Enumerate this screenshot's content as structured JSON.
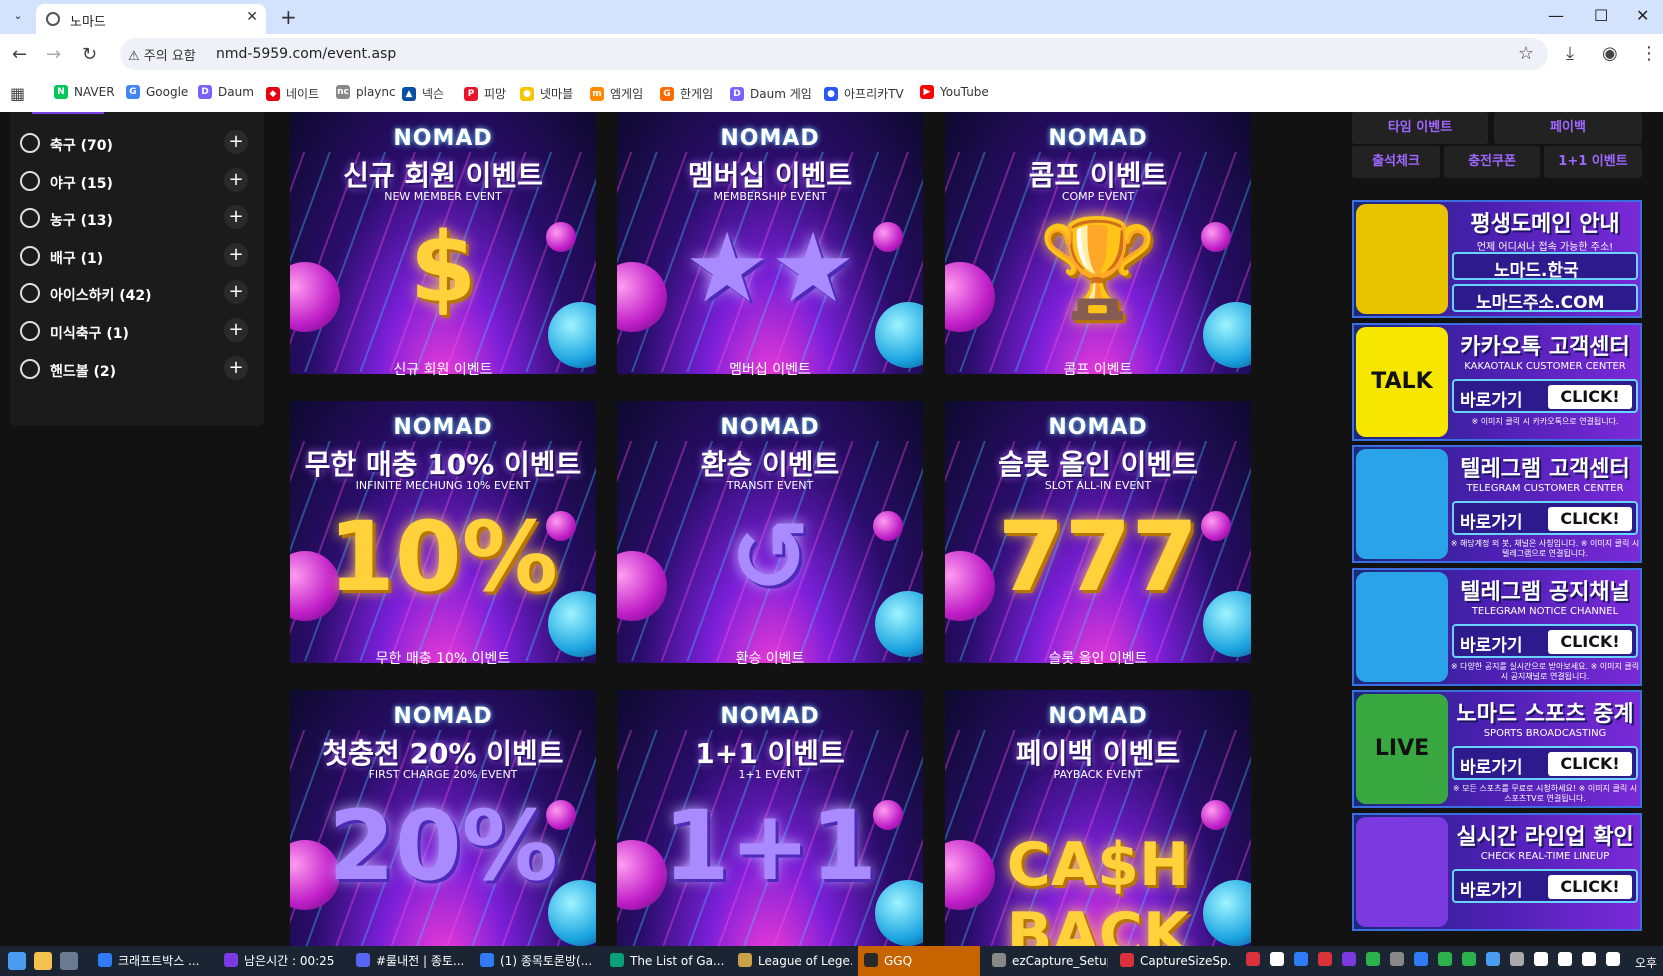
{
  "browser": {
    "tab_title": "노마드",
    "security_label": "주의 요함",
    "url": "nmd-5959.com/event.asp",
    "bookmarks": [
      {
        "label": "NAVER",
        "color": "#03c75a",
        "glyph": "N"
      },
      {
        "label": "Google",
        "color": "#4285f4",
        "glyph": "G"
      },
      {
        "label": "Daum",
        "color": "#7b61ff",
        "glyph": "D"
      },
      {
        "label": "네이트",
        "color": "#e60012",
        "glyph": "◆"
      },
      {
        "label": "plaync",
        "color": "#888888",
        "glyph": "nc"
      },
      {
        "label": "넥슨",
        "color": "#0b4fa3",
        "glyph": "▲"
      },
      {
        "label": "피망",
        "color": "#e8142a",
        "glyph": "P"
      },
      {
        "label": "넷마블",
        "color": "#f7c600",
        "glyph": "●"
      },
      {
        "label": "엠게임",
        "color": "#ff8a00",
        "glyph": "m"
      },
      {
        "label": "한게임",
        "color": "#ff6a00",
        "glyph": "G"
      },
      {
        "label": "Daum 게임",
        "color": "#7b61ff",
        "glyph": "D"
      },
      {
        "label": "아프리카TV",
        "color": "#2b56f0",
        "glyph": "●"
      },
      {
        "label": "YouTube",
        "color": "#ff0000",
        "glyph": "▶"
      }
    ]
  },
  "sidebar": {
    "sports": [
      {
        "label": "축구 (70)",
        "icon": "soccer-ball-icon"
      },
      {
        "label": "야구 (15)",
        "icon": "baseball-icon"
      },
      {
        "label": "농구 (13)",
        "icon": "basketball-icon"
      },
      {
        "label": "배구 (1)",
        "icon": "volleyball-icon"
      },
      {
        "label": "아이스하키 (42)",
        "icon": "hockey-puck-icon"
      },
      {
        "label": "미식축구 (1)",
        "icon": "football-icon"
      },
      {
        "label": "핸드볼 (2)",
        "icon": "handball-icon"
      }
    ],
    "expand_glyph": "+"
  },
  "events": [
    {
      "brand": "NOMAD",
      "title": "신규 회원 이벤트",
      "subtitle": "NEW MEMBER EVENT",
      "art": "$",
      "caption": "신규 회원 이벤트"
    },
    {
      "brand": "NOMAD",
      "title": "멤버십 이벤트",
      "subtitle": "MEMBERSHIP EVENT",
      "art": "★★",
      "caption": "멤버십 이벤트"
    },
    {
      "brand": "NOMAD",
      "title": "콤프 이벤트",
      "subtitle": "COMP EVENT",
      "art": "🏆",
      "caption": "콤프 이벤트"
    },
    {
      "brand": "NOMAD",
      "title": "무한 매충 10% 이벤트",
      "subtitle": "INFINITE MECHUNG 10% EVENT",
      "art": "10%",
      "caption": "무한 매충 10% 이벤트"
    },
    {
      "brand": "NOMAD",
      "title": "환승 이벤트",
      "subtitle": "TRANSIT EVENT",
      "art": "↺",
      "caption": "환승 이벤트"
    },
    {
      "brand": "NOMAD",
      "title": "슬롯 올인 이벤트",
      "subtitle": "SLOT ALL-IN EVENT",
      "art": "777",
      "caption": "슬롯 올인 이벤트"
    },
    {
      "brand": "NOMAD",
      "title": "첫충전 20% 이벤트",
      "subtitle": "FIRST CHARGE 20% EVENT",
      "art": "20%",
      "caption": ""
    },
    {
      "brand": "NOMAD",
      "title": "1+1 이벤트",
      "subtitle": "1+1 EVENT",
      "art": "1+1",
      "caption": ""
    },
    {
      "brand": "NOMAD",
      "title": "페이백 이벤트",
      "subtitle": "PAYBACK EVENT",
      "art": "CA$H BACK",
      "caption": ""
    }
  ],
  "event_tabs": [
    "타임 이벤트",
    "페이백",
    "출석체크",
    "충전쿠폰",
    "1+1 이벤트"
  ],
  "side_banners": [
    {
      "title": "평생도메인 안내",
      "subtitle": "언제 어디서나 접속 가능한 주소!",
      "line1": "노마드.한국",
      "line2": "노마드주소.COM",
      "note": "",
      "logo_color": "#e8c400",
      "icon": "chrome-logo-icon"
    },
    {
      "title": "카카오톡 고객센터",
      "subtitle": "KAKAOTALK CUSTOMER CENTER",
      "cta": "바로가기",
      "click": "CLICK!",
      "note": "※ 이미지 클릭 시 카카오톡으로 연결됩니다.",
      "logo_color": "#f7e600",
      "icon": "kakaotalk-icon",
      "logo_text": "TALK"
    },
    {
      "title": "텔레그램 고객센터",
      "subtitle": "TELEGRAM CUSTOMER CENTER",
      "cta": "바로가기",
      "click": "CLICK!",
      "note": "※ 해당계정 외 봇, 채널은 사칭입니다. ※ 이미지 클릭 시 텔레그램으로 연결됩니다.",
      "logo_color": "#2aa3e8",
      "icon": "telegram-icon"
    },
    {
      "title": "텔레그램 공지채널",
      "subtitle": "TELEGRAM NOTICE CHANNEL",
      "cta": "바로가기",
      "click": "CLICK!",
      "note": "※ 다양한 공지를 실시간으로 받아보세요. ※ 이미지 클릭 시 공지채널로 연결됩니다.",
      "logo_color": "#2aa3e8",
      "icon": "telegram-icon"
    },
    {
      "title": "노마드 스포츠 중계",
      "subtitle": "SPORTS BROADCASTING",
      "cta": "바로가기",
      "click": "CLICK!",
      "note": "※ 모든 스포츠를 무료로 시청하세요! ※ 이미지 클릭 시 스포츠TV로 연결됩니다.",
      "logo_color": "#3aa840",
      "icon": "soccer-tv-icon",
      "logo_text": "LIVE"
    },
    {
      "title": "실시간 라인업 확인",
      "subtitle": "CHECK REAL-TIME LINEUP",
      "cta": "바로가기",
      "click": "CLICK!",
      "note": "",
      "logo_color": "#7a3ae0",
      "icon": "sports-players-icon"
    }
  ],
  "taskbar": {
    "apps": [
      {
        "label": "크래프트박스 ...",
        "color": "#2f7cf6",
        "active": false
      },
      {
        "label": "남은시간 : 00:25",
        "color": "#7a3ae0",
        "active": false
      },
      {
        "label": "#룰내전 | 종토...",
        "color": "#5865f2",
        "active": false
      },
      {
        "label": "(1) 종목토론방(...",
        "color": "#2f7cf6",
        "active": false
      },
      {
        "label": "The List of Ga...",
        "color": "#0aa07a",
        "active": false
      },
      {
        "label": "League of Lege...",
        "color": "#c8a24a",
        "active": false
      },
      {
        "label": "GGQ",
        "color": "#2a2a2a",
        "active": true
      },
      {
        "label": "ezCapture_Setup",
        "color": "#888888",
        "active": false
      },
      {
        "label": "CaptureSizeSp...",
        "color": "#d9323a",
        "active": false
      }
    ],
    "clock": "오후"
  }
}
